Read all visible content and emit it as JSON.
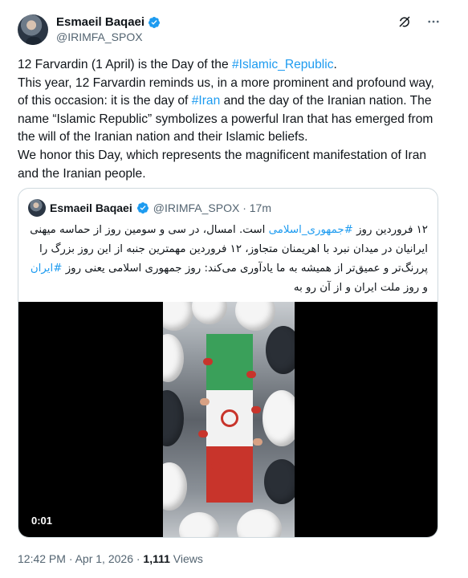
{
  "author": {
    "display_name": "Esmaeil Baqaei",
    "handle": "@IRIMFA_SPOX"
  },
  "header_icons": [
    "grok-icon",
    "more-options-icon"
  ],
  "tweet": {
    "segments": {
      "p1_a": "12 Farvardin (1 April) is the Day of the ",
      "p1_link": "#Islamic_Republic",
      "p1_b": ".",
      "p2_a": "This year, 12 Farvardin reminds us, in a more prominent and profound way, of this occasion: it is the day of ",
      "p2_link": "#Iran",
      "p2_b": " and the day of the Iranian nation. The name “Islamic Republic” symbolizes a powerful Iran that has emerged from the will of the Iranian nation and their Islamic beliefs.",
      "p3": "We honor this Day, which represents the magnificent manifestation of Iran and the Iranian people."
    }
  },
  "quote": {
    "display_name": "Esmaeil Baqaei",
    "handle_time": "@IRIMFA_SPOX · 17m",
    "text": {
      "a": "۱۲ فروردین روز ",
      "link1": "#جمهوری_اسلامی",
      "b": " است. امسال، در سی و سومین روز از حماسه میهنی ایرانیان در میدان نبرد با اهریمنان متجاوز، ۱۲ فروردین مهمترین جنبه از این روز بزرگ را پررنگ‌تر و عمیق‌تر از همیشه به ما یادآوری می‌کند: روز جمهوری اسلامی یعنی روز ",
      "link2": "#ایران",
      "c": " و روز ملت ایران و از آن رو به"
    },
    "video_time": "0:01"
  },
  "meta": {
    "time_date": "12:42 PM · Apr 1, 2026 · ",
    "views_count": "1,111",
    "views_label": " Views"
  },
  "colors": {
    "accent": "#1d9bf0",
    "text": "#0f1419",
    "secondary": "#536471",
    "border": "#cfd9de"
  }
}
